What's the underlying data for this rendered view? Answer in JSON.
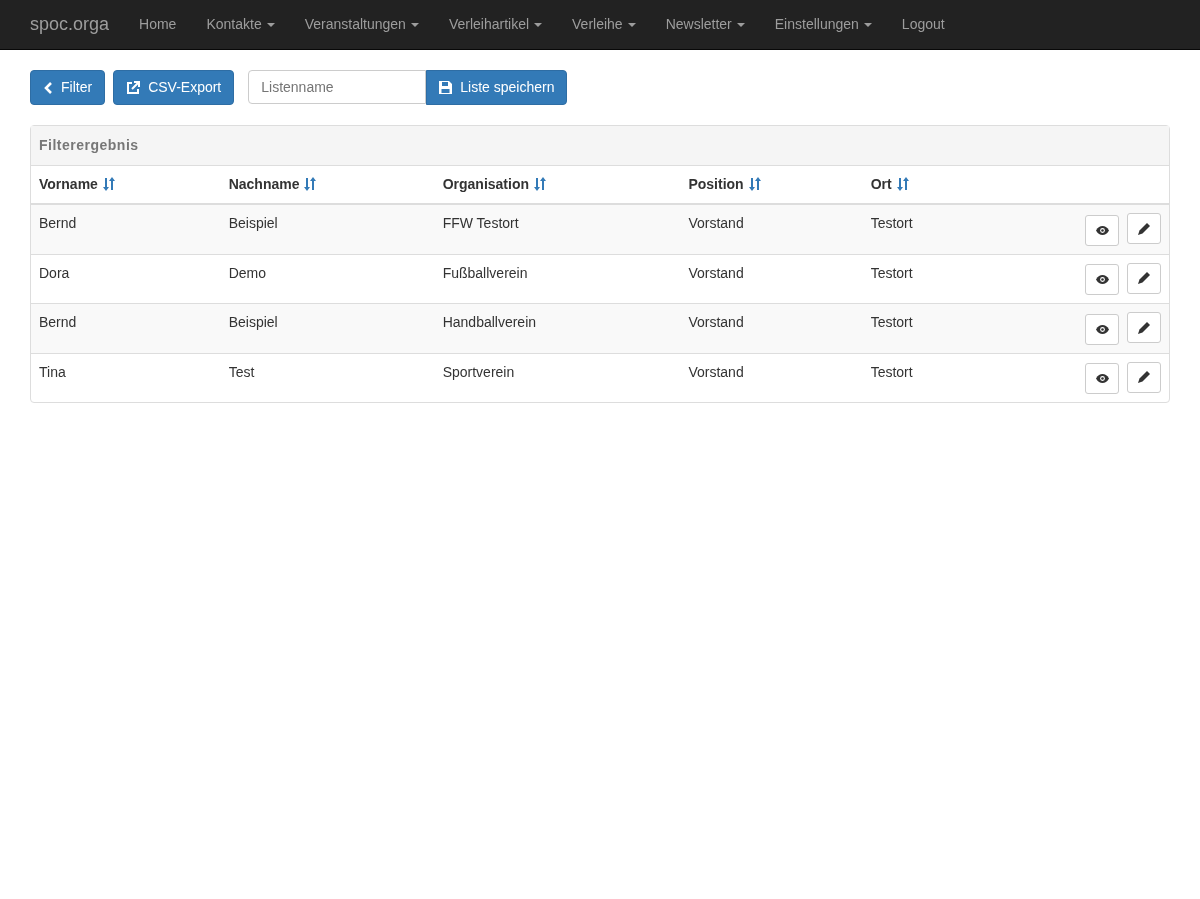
{
  "navbar": {
    "brand": "spoc.orga",
    "items": [
      {
        "label": "Home",
        "dropdown": false
      },
      {
        "label": "Kontakte",
        "dropdown": true
      },
      {
        "label": "Veranstaltungen",
        "dropdown": true
      },
      {
        "label": "Verleihartikel",
        "dropdown": true
      },
      {
        "label": "Verleihe",
        "dropdown": true
      },
      {
        "label": "Newsletter",
        "dropdown": true
      },
      {
        "label": "Einstellungen",
        "dropdown": true
      },
      {
        "label": "Logout",
        "dropdown": false
      }
    ]
  },
  "toolbar": {
    "filter_button": "Filter",
    "export_button": "CSV-Export",
    "list_name": {
      "placeholder": "Listenname"
    },
    "save_button": "Liste speichern"
  },
  "panel": {
    "title": "Filterergebnis",
    "table": {
      "columns": [
        "Vorname",
        "Nachname",
        "Organisation",
        "Position",
        "Ort"
      ],
      "rows": [
        [
          "Bernd",
          "Beispiel",
          "FFW Testort",
          "Vorstand",
          "Testort"
        ],
        [
          "Dora",
          "Demo",
          "Fußballverein",
          "Vorstand",
          "Testort"
        ],
        [
          "Bernd",
          "Beispiel",
          "Handballverein",
          "Vorstand",
          "Testort"
        ],
        [
          "Tina",
          "Test",
          "Sportverein",
          "Vorstand",
          "Testort"
        ]
      ]
    }
  }
}
